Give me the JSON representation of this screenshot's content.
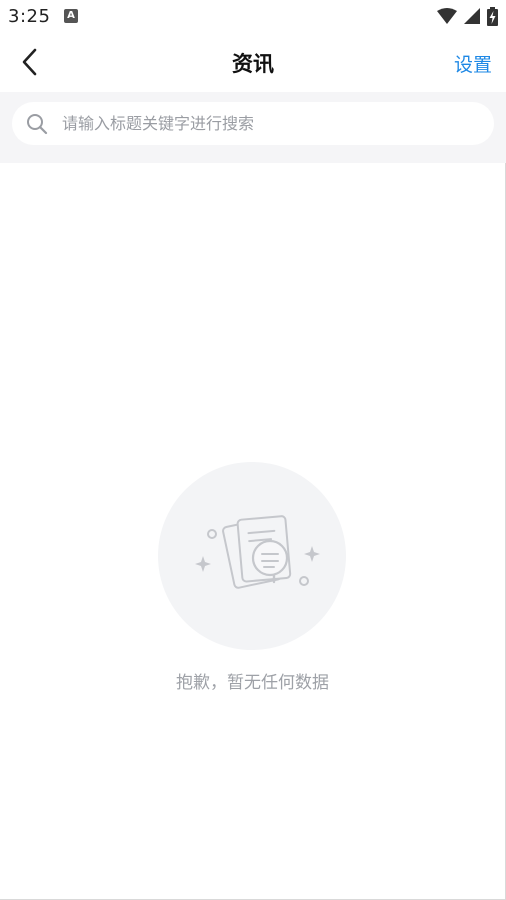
{
  "status_bar": {
    "time": "3:25",
    "notification_icon": "font-a-icon",
    "icons": [
      "wifi-icon",
      "cellular-signal-icon",
      "battery-charging-icon"
    ]
  },
  "header": {
    "back_icon": "chevron-left-icon",
    "title": "资讯",
    "settings_label": "设置",
    "settings_color": "#1e88e5"
  },
  "search": {
    "icon": "search-icon",
    "placeholder": "请输入标题关键字进行搜索",
    "value": ""
  },
  "empty_state": {
    "illustration": "empty-documents-icon",
    "message": "抱歉，暂无任何数据"
  }
}
